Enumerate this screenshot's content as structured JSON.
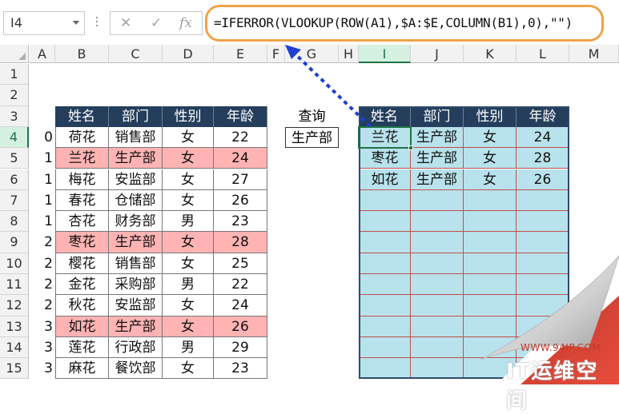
{
  "formula_bar": {
    "name_box": "I4",
    "cancel_icon": "✕",
    "enter_icon": "✓",
    "fx_icon": "fx",
    "formula": "=IFERROR(VLOOKUP(ROW(A1),$A:$E,COLUMN(B1),0),\"\")"
  },
  "columns": [
    "A",
    "B",
    "C",
    "D",
    "E",
    "F",
    "G",
    "H",
    "I",
    "J",
    "K",
    "L",
    "M"
  ],
  "rows": [
    "1",
    "2",
    "3",
    "4",
    "5",
    "6",
    "7",
    "8",
    "9",
    "10",
    "11",
    "12",
    "13",
    "14",
    "15"
  ],
  "selected": {
    "column": "I",
    "row": "4"
  },
  "source_table": {
    "headers": [
      "姓名",
      "部门",
      "性别",
      "年龄"
    ],
    "rows": [
      {
        "a": "0",
        "name": "荷花",
        "dept": "销售部",
        "sex": "女",
        "age": "22",
        "hl": false
      },
      {
        "a": "1",
        "name": "兰花",
        "dept": "生产部",
        "sex": "女",
        "age": "24",
        "hl": true
      },
      {
        "a": "1",
        "name": "梅花",
        "dept": "安监部",
        "sex": "女",
        "age": "27",
        "hl": false
      },
      {
        "a": "1",
        "name": "春花",
        "dept": "仓储部",
        "sex": "女",
        "age": "26",
        "hl": false
      },
      {
        "a": "1",
        "name": "杏花",
        "dept": "财务部",
        "sex": "男",
        "age": "23",
        "hl": false
      },
      {
        "a": "2",
        "name": "枣花",
        "dept": "生产部",
        "sex": "女",
        "age": "28",
        "hl": true
      },
      {
        "a": "2",
        "name": "樱花",
        "dept": "销售部",
        "sex": "女",
        "age": "25",
        "hl": false
      },
      {
        "a": "2",
        "name": "金花",
        "dept": "采购部",
        "sex": "男",
        "age": "22",
        "hl": false
      },
      {
        "a": "2",
        "name": "秋花",
        "dept": "安监部",
        "sex": "女",
        "age": "24",
        "hl": false
      },
      {
        "a": "3",
        "name": "如花",
        "dept": "生产部",
        "sex": "女",
        "age": "26",
        "hl": true
      },
      {
        "a": "3",
        "name": "莲花",
        "dept": "行政部",
        "sex": "男",
        "age": "29",
        "hl": false
      },
      {
        "a": "3",
        "name": "麻花",
        "dept": "餐饮部",
        "sex": "女",
        "age": "23",
        "hl": false
      }
    ]
  },
  "query": {
    "label": "查询",
    "value": "生产部"
  },
  "result_table": {
    "headers": [
      "姓名",
      "部门",
      "性别",
      "年龄"
    ],
    "rows": [
      [
        "兰花",
        "生产部",
        "女",
        "24"
      ],
      [
        "枣花",
        "生产部",
        "女",
        "28"
      ],
      [
        "如花",
        "生产部",
        "女",
        "26"
      ],
      [
        "",
        "",
        "",
        ""
      ],
      [
        "",
        "",
        "",
        ""
      ],
      [
        "",
        "",
        "",
        ""
      ],
      [
        "",
        "",
        "",
        ""
      ],
      [
        "",
        "",
        "",
        ""
      ],
      [
        "",
        "",
        "",
        ""
      ],
      [
        "",
        "",
        "",
        ""
      ],
      [
        "",
        "",
        "",
        ""
      ],
      [
        "",
        "",
        "",
        ""
      ]
    ]
  },
  "watermark": {
    "url": "WWW.94IP.COM",
    "brand": "IT运维空间"
  },
  "colors": {
    "header_bg": "#243e5c",
    "highlight": "#ffb3b3",
    "result_bg": "#b8e2ec",
    "formula_border": "#f0a24a",
    "arrow": "#1f3fd1"
  }
}
